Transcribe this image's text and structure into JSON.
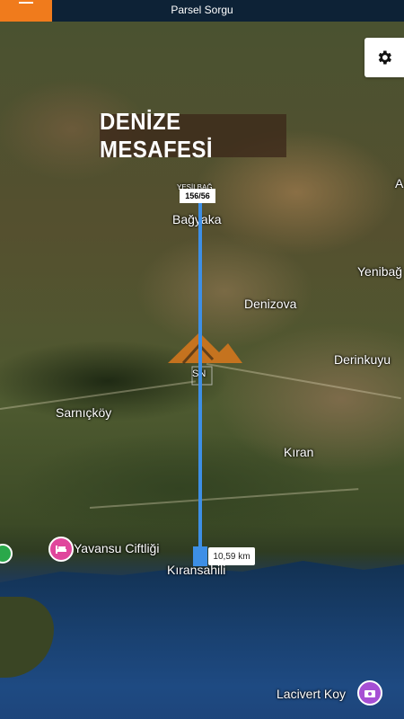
{
  "header": {
    "title": "Parsel Sorgu",
    "menu_icon": "hamburger-icon",
    "accent_color": "#f07b1c",
    "bar_color": "#0d2236"
  },
  "settings": {
    "icon": "gear-icon"
  },
  "banner": {
    "text": "DENİZE MESAFESİ"
  },
  "route": {
    "parcel_label": "156/56",
    "distance": "10,59 km",
    "line_color": "#3d8fe6"
  },
  "places": {
    "bagyaka": "Bağyaka",
    "yesilbag": "YEŞİLBAĞ",
    "denizova": "Denizova",
    "yenibag": "Yenibağ",
    "derinkuyu": "Derinkuyu",
    "sarnickoy": "Sarnıçköy",
    "kiran": "Kıran",
    "yavansu": "Yavansu Ciftliği",
    "kiransahili": "Kıransahili",
    "lacivert": "Lacivert Koy",
    "a_edge": "A"
  },
  "watermark": {
    "text": "SN"
  }
}
